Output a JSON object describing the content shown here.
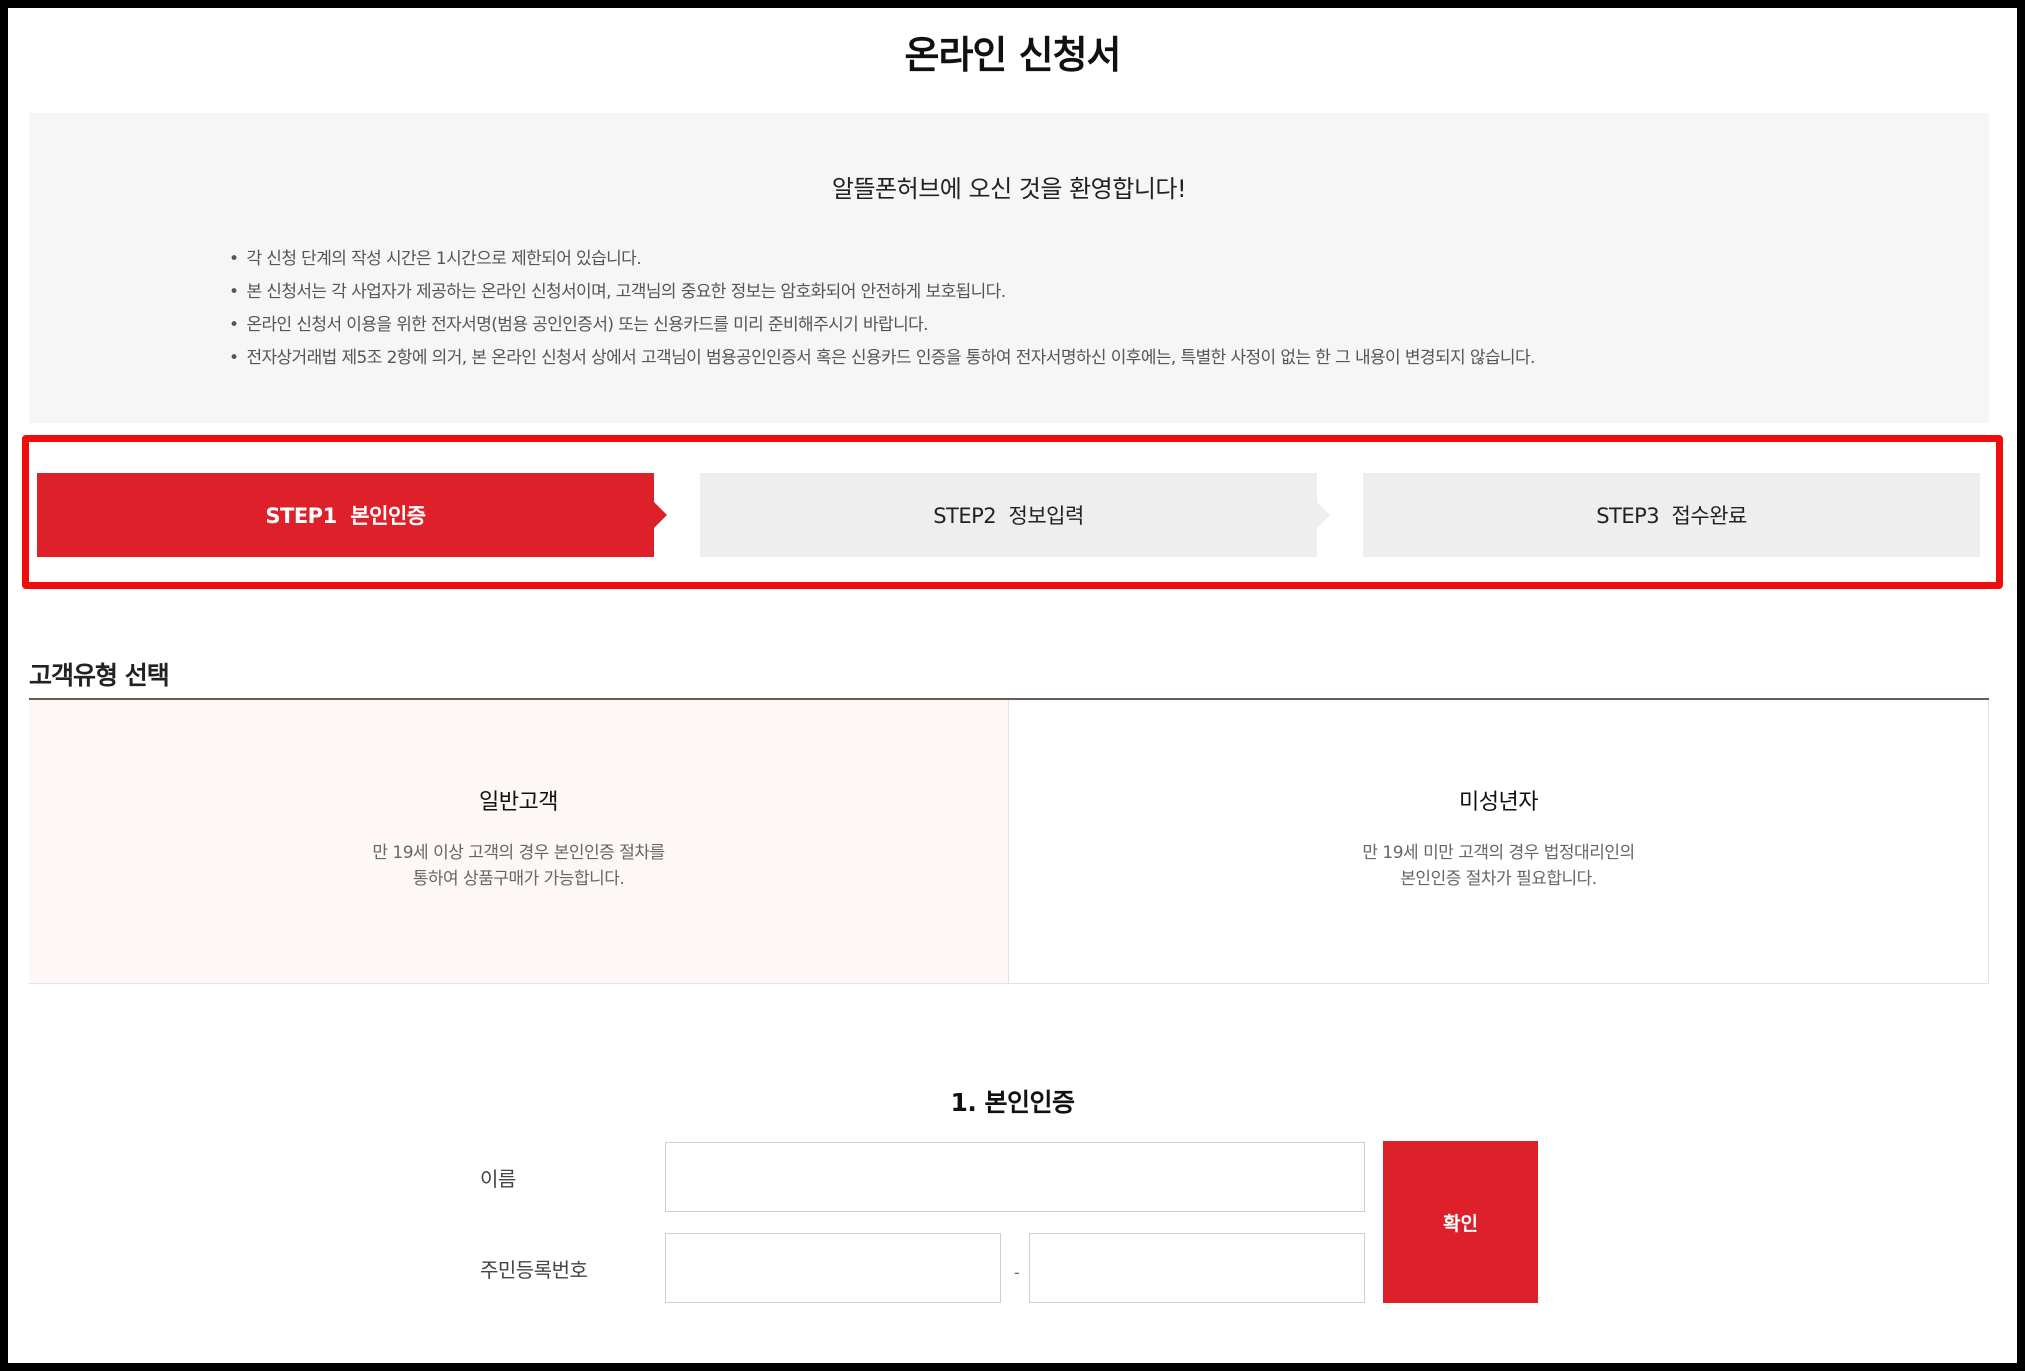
{
  "page": {
    "title": "온라인 신청서"
  },
  "notice": {
    "title": "알뜰폰허브에 오신 것을 환영합니다!",
    "items": [
      "각 신청 단계의 작성 시간은 1시간으로 제한되어 있습니다.",
      "본 신청서는 각 사업자가 제공하는 온라인 신청서이며, 고객님의 중요한 정보는 암호화되어 안전하게 보호됩니다.",
      "온라인 신청서 이용을 위한 전자서명(범용 공인인증서) 또는 신용카드를 미리 준비해주시기 바랍니다.",
      "전자상거래법 제5조 2항에 의거, 본 온라인 신청서 상에서 고객님이 범용공인인증서 혹은 신용카드 인증을 통하여 전자서명하신 이후에는, 특별한 사정이 없는 한 그 내용이 변경되지 않습니다."
    ]
  },
  "steps": [
    {
      "label": "STEP1  본인인증",
      "active": true
    },
    {
      "label": "STEP2  정보입력",
      "active": false
    },
    {
      "label": "STEP3  접수완료",
      "active": false
    }
  ],
  "customer_type": {
    "title": "고객유형 선택",
    "options": [
      {
        "title": "일반고객",
        "desc_line1": "만 19세 이상 고객의 경우 본인인증 절차를",
        "desc_line2": "통하여 상품구매가 가능합니다.",
        "selected": true
      },
      {
        "title": "미성년자",
        "desc_line1": "만 19세 미만 고객의 경우 법정대리인의",
        "desc_line2": "본인인증 절차가 필요합니다.",
        "selected": false
      }
    ]
  },
  "auth": {
    "title": "1. 본인인증",
    "name_label": "이름",
    "name_value": "",
    "rrn_label": "주민등록번호",
    "rrn_front_value": "",
    "rrn_back_value": "",
    "dash": "-",
    "confirm_label": "확인"
  },
  "colors": {
    "accent": "#dd202a",
    "highlight_border": "#f00c0c",
    "notice_bg": "#f6f6f6",
    "step_inactive_bg": "#eeeeee",
    "selected_card_bg": "#fdf8f5"
  }
}
